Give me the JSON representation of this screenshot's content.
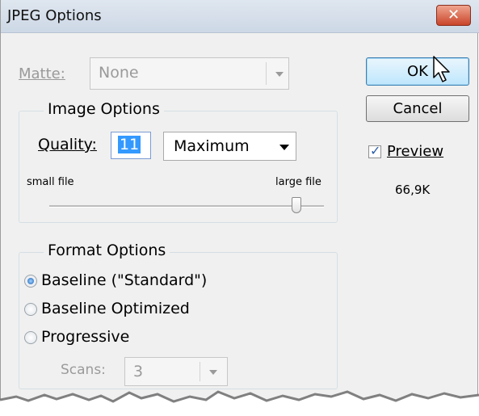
{
  "window": {
    "title": "JPEG Options",
    "close_glyph": "✕"
  },
  "matte": {
    "label": "Matte:",
    "value": "None"
  },
  "buttons": {
    "ok": "OK",
    "cancel": "Cancel"
  },
  "preview": {
    "label": "Preview",
    "checked": true,
    "file_size": "66,9K"
  },
  "image_options": {
    "title": "Image Options",
    "quality_label": "Quality:",
    "quality_value": "11",
    "quality_preset": "Maximum",
    "small_label": "small file",
    "large_label": "large file",
    "slider_level": 0.92
  },
  "format_options": {
    "title": "Format Options",
    "options": [
      {
        "label": "Baseline (\"Standard\")",
        "selected": true
      },
      {
        "label": "Baseline Optimized",
        "selected": false
      },
      {
        "label": "Progressive",
        "selected": false
      }
    ],
    "scans_label": "Scans:",
    "scans_value": "3"
  },
  "colors": {
    "accent": "#3399ff",
    "close": "#c9452a",
    "default_button": "#bee6fd"
  }
}
